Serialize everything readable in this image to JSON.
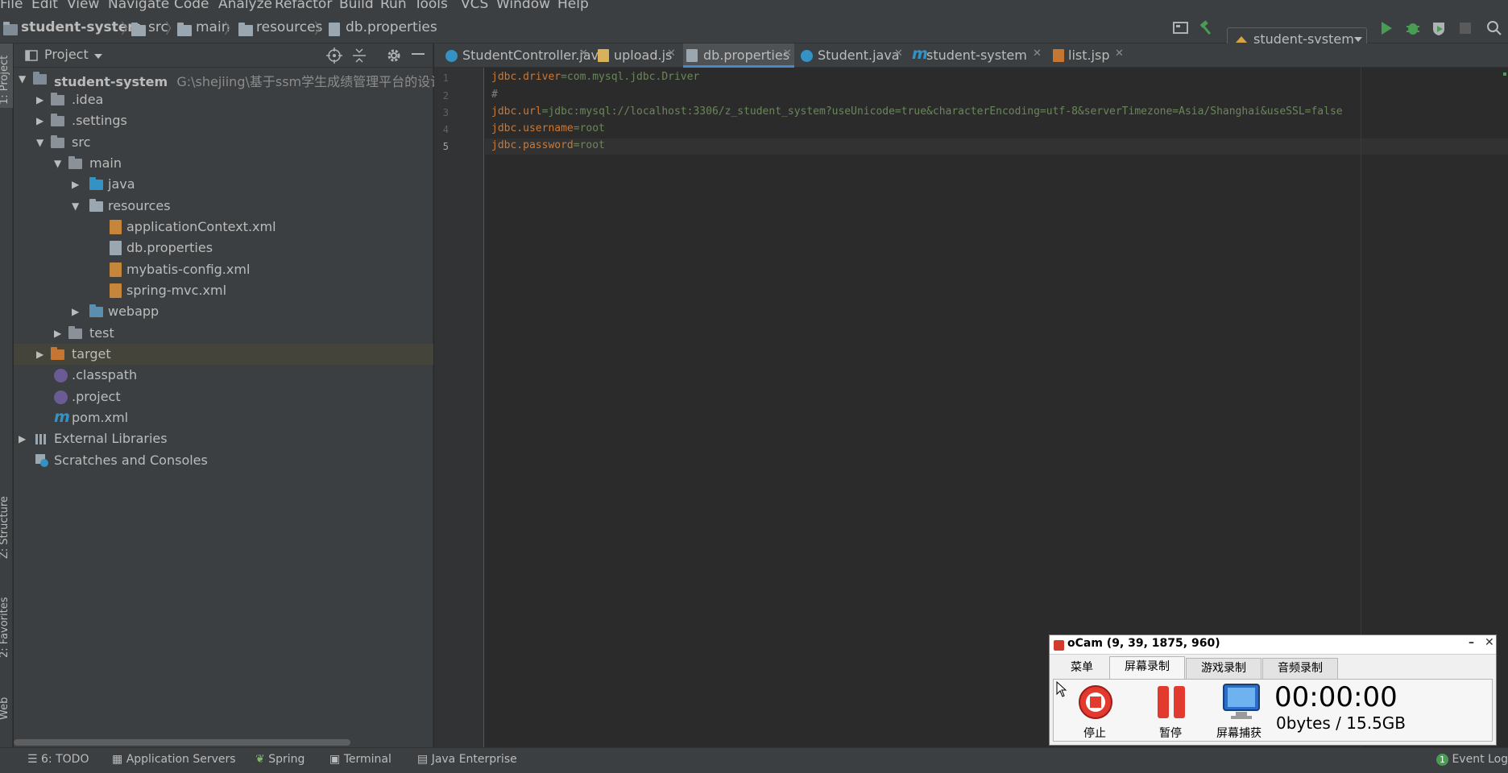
{
  "menu": [
    "File",
    "Edit",
    "View",
    "Navigate",
    "Code",
    "Analyze",
    "Refactor",
    "Build",
    "Run",
    "Tools",
    "VCS",
    "Window",
    "Help"
  ],
  "breadcrumbs": [
    "student-system",
    "src",
    "main",
    "resources",
    "db.properties"
  ],
  "run_config": "student-system",
  "left_strip": {
    "project": "1: Project",
    "structure": "Z: Structure",
    "favorites": "2: Favorites",
    "web": "Web"
  },
  "project_panel": {
    "title": "Project",
    "tree": [
      {
        "label": "student-system",
        "path": "G:\\shejiing\\基于ssm学生成绩管理平台的设计与实现"
      },
      {
        "label": ".idea"
      },
      {
        "label": ".settings"
      },
      {
        "label": "src"
      },
      {
        "label": "main"
      },
      {
        "label": "java"
      },
      {
        "label": "resources"
      },
      {
        "label": "applicationContext.xml"
      },
      {
        "label": "db.properties"
      },
      {
        "label": "mybatis-config.xml"
      },
      {
        "label": "spring-mvc.xml"
      },
      {
        "label": "webapp"
      },
      {
        "label": "test"
      },
      {
        "label": "target"
      },
      {
        "label": ".classpath"
      },
      {
        "label": ".project"
      },
      {
        "label": "pom.xml"
      },
      {
        "label": "External Libraries"
      },
      {
        "label": "Scratches and Consoles"
      }
    ]
  },
  "tabs": [
    {
      "label": "StudentController.java",
      "icon": "class-icon"
    },
    {
      "label": "upload.js",
      "icon": "js-file-icon"
    },
    {
      "label": "db.properties",
      "icon": "properties-file-icon",
      "active": true
    },
    {
      "label": "Student.java",
      "icon": "class-icon"
    },
    {
      "label": "student-system",
      "icon": "maven-icon"
    },
    {
      "label": "list.jsp",
      "icon": "jsp-file-icon"
    }
  ],
  "editor": {
    "lines": [
      {
        "num": "1",
        "key": "jdbc.driver",
        "eq": "=",
        "val": "com.mysql.jdbc.Driver"
      },
      {
        "num": "2",
        "key": "",
        "eq": "",
        "val": "#"
      },
      {
        "num": "3",
        "key": "jdbc.url",
        "eq": "=",
        "val": "jdbc:mysql://localhost:3306/z_student_system?useUnicode=true&characterEncoding=utf-8&serverTimezone=Asia/Shanghai&useSSL=false"
      },
      {
        "num": "4",
        "key": "jdbc.username",
        "eq": "=",
        "val": "root"
      },
      {
        "num": "5",
        "key": "jdbc.password",
        "eq": "=",
        "val": "root"
      }
    ]
  },
  "bottom_bar": {
    "todo": "6: TODO",
    "app_servers": "Application Servers",
    "spring": "Spring",
    "terminal": "Terminal",
    "java_ee": "Java Enterprise",
    "event_log": "Event Log",
    "event_count": "1"
  },
  "ocam": {
    "title": "oCam (9, 39, 1875, 960)",
    "tabs": [
      "菜单",
      "屏幕录制",
      "游戏录制",
      "音频录制"
    ],
    "stop": "停止",
    "pause": "暂停",
    "capture": "屏幕捕获",
    "timer": "00:00:00",
    "size": "0bytes / 15.5GB"
  },
  "colors": {
    "accent": "#4a88c7",
    "keyword": "#cc7832",
    "string": "#6a8759",
    "run_green": "#499c54"
  }
}
